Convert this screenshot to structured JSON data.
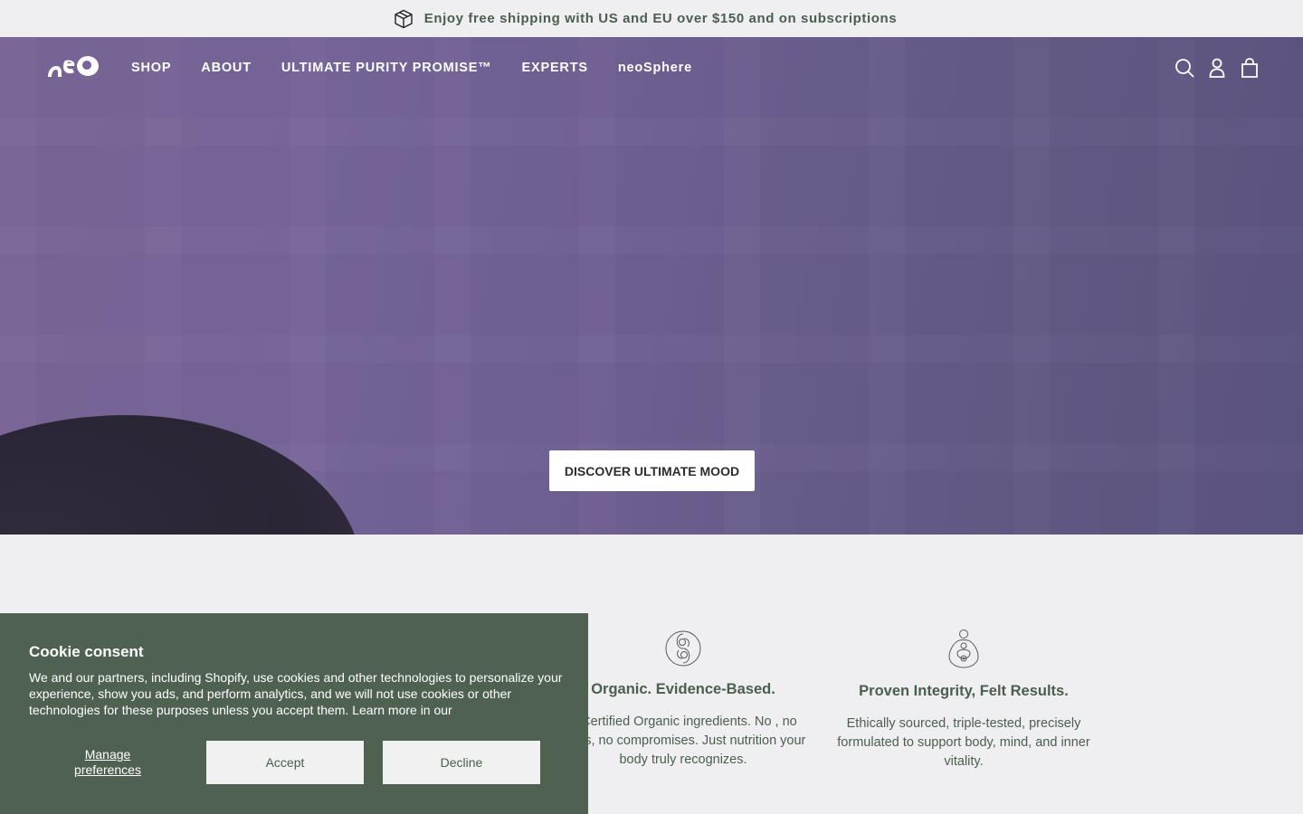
{
  "announcement": {
    "text": "Enjoy free shipping with US and EU over $150 and on subscriptions",
    "icon": "package-icon"
  },
  "nav": {
    "logo_icon": "neo-logo-icon",
    "links": [
      "SHOP",
      "ABOUT",
      "ULTIMATE PURITY PROMISE™",
      "EXPERTS",
      "neoSphere"
    ],
    "icons": [
      "search-icon",
      "account-icon",
      "cart-icon"
    ]
  },
  "hero": {
    "cta_label": "DISCOVER ULTIMATE MOOD"
  },
  "features": [
    {
      "icon": "yin-yang-icon",
      "title": "Organic. Evidence-Based.",
      "body": "A Certified Organic ingredients. No , no fillers, no compromises. Just nutrition your body truly recognizes."
    },
    {
      "icon": "nesting-figure-icon",
      "title": "Proven Integrity, Felt Results.",
      "body": "Ethically sourced, triple-tested, precisely formulated to support body, mind, and inner vitality."
    }
  ],
  "cookie": {
    "title": "Cookie consent",
    "description": "We and our partners, including Shopify, use cookies and other technologies to personalize your experience, show you ads, and perform analytics, and we will not use cookies or other technologies for these purposes unless you accept them. Learn more in our",
    "manage_label": "Manage preferences",
    "accept_label": "Accept",
    "decline_label": "Decline"
  },
  "colors": {
    "brand_green": "#4b5f4e",
    "cookie_bg": "#4f6150",
    "hero_purple": "#76659a"
  }
}
